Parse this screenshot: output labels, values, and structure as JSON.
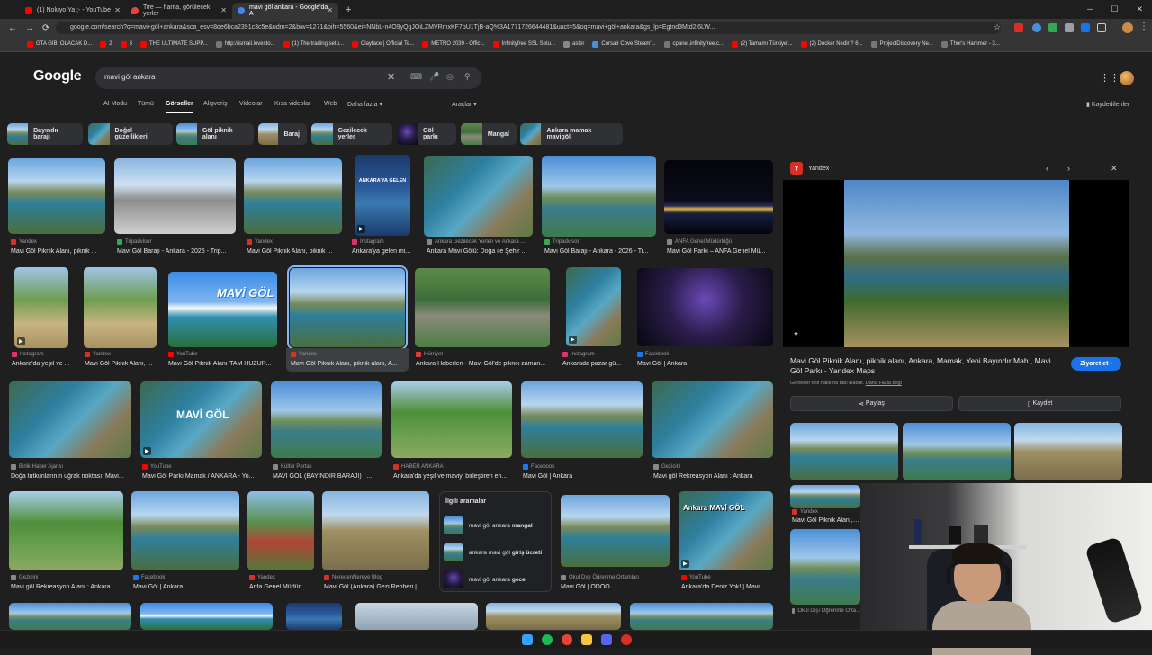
{
  "tabs": [
    {
      "title": "(1) Noluyo Ya ;- - YouTube",
      "color": "#ff0000"
    },
    {
      "title": "Tire — harita, görülecek yerler",
      "color": "#ea4335"
    },
    {
      "title": "mavi göl ankara - Google'da A",
      "color": "#4285f4"
    }
  ],
  "address": {
    "url": "google.com/search?q=mavi+göl+ankara&sca_esv=8de6bca2391c3c5e&udm=2&biw=1271&bih=5560&ei=NNbL-n4O9yQgJOiLZMVRmxKF7bU1TjB-aQ%3A1771726644481&uact=5&oq=mavi+göl+ankara&gs_lp=Egtnd3Mtd2l6LW..."
  },
  "bookmarks": [
    {
      "label": "GTA GİBİ OLACAK D...",
      "color": "#ff0000"
    },
    {
      "label": "2",
      "color": "#ff0000"
    },
    {
      "label": "3",
      "color": "#ff0000"
    },
    {
      "label": "THE ULTIMATE SUPP...",
      "color": "#ff0000"
    },
    {
      "label": "http://ismail.lovesto...",
      "color": "#777777"
    },
    {
      "label": "(1) The trading setu...",
      "color": "#ff0000"
    },
    {
      "label": "Clayface | Official Te...",
      "color": "#ff0000"
    },
    {
      "label": "METRO 2039 - Offic...",
      "color": "#ff0000"
    },
    {
      "label": "Infinityfree SSL Setu...",
      "color": "#ff0000"
    },
    {
      "label": "aster",
      "color": "#888888"
    },
    {
      "label": "Corsair Cove Steam'...",
      "color": "#4a90d9"
    },
    {
      "label": "cpanel.infinityfree.c...",
      "color": "#777777"
    },
    {
      "label": "(2) Tamamı Türkiye'...",
      "color": "#ff0000"
    },
    {
      "label": "(2) Docker Nedir ? 6...",
      "color": "#ff0000"
    },
    {
      "label": "ProjectDiscovery Ne...",
      "color": "#777777"
    },
    {
      "label": "Thor's Hammer - 3...",
      "color": "#777777"
    }
  ],
  "google": {
    "logo": "Google",
    "query": "mavi göl ankara",
    "nav": [
      "AI Modu",
      "Tümü",
      "Görseller",
      "Alışveriş",
      "Videolar",
      "Kısa videolar",
      "Web",
      "Daha fazla",
      "Araçlar"
    ],
    "saved": "Kaydedilenler"
  },
  "chips": [
    "Bayındır barajı",
    "Doğal güzellikleri",
    "Göl piknik alanı",
    "Baraj",
    "Gezilecek yerler",
    "Göl parkı",
    "Mangal",
    "Ankara mamak mavigöl"
  ],
  "results": [
    {
      "source": "Yandex",
      "caption": "Mavi Göl Piknik Alanı, piknik ...",
      "src_color": "#d93025"
    },
    {
      "source": "Tripadvisor",
      "caption": "Mavi Göl Barajı - Ankara - 2026 - Trip...",
      "src_color": "#34a853"
    },
    {
      "source": "Yandex",
      "caption": "Mavi Göl Piknik Alanı, piknik ...",
      "src_color": "#d93025"
    },
    {
      "source": "Instagram",
      "caption": "Ankara'ya gelen mi...",
      "src_color": "#e1306c"
    },
    {
      "source": "Ankara Gezilecek Yerleri ve Ankara ...",
      "caption": "Ankara Mavi Gölü: Doğa ile Şehir ...",
      "src_color": "#888888"
    },
    {
      "source": "Tripadvisor",
      "caption": "Mavi Göl Barajı - Ankara - 2026 - Tr...",
      "src_color": "#34a853"
    },
    {
      "source": "ANFA Genel Müdürlüğü",
      "caption": "Mavi Göl Parkı – ANFA Genel Mü...",
      "src_color": "#888888"
    },
    {
      "source": "Instagram",
      "caption": "Ankara'da yeşil ve ...",
      "src_color": "#e1306c"
    },
    {
      "source": "Yandex",
      "caption": "Mavi Göl Piknik Alanı, ...",
      "src_color": "#d93025"
    },
    {
      "source": "YouTube",
      "caption": "Mavi Göl Piknik Alanı-TAM HUZUR...",
      "src_color": "#ff0000"
    },
    {
      "source": "Yandex",
      "caption": "Mavi Göl Piknik Alanı, piknik alanı, A...",
      "src_color": "#d93025"
    },
    {
      "source": "Hürriyet",
      "caption": "Ankara Haberleri - Mavi Göl'de piknik zaman...",
      "src_color": "#e53935"
    },
    {
      "source": "Instagram",
      "caption": "Ankarada pazar gü...",
      "src_color": "#e1306c"
    },
    {
      "source": "Facebook",
      "caption": "Mavi Göl | Ankara",
      "src_color": "#1877f2"
    },
    {
      "source": "Birlik Haber Ajansı",
      "caption": "Doğa tutkunlarının uğrak noktası: Mavi...",
      "src_color": "#888888"
    },
    {
      "source": "YouTube",
      "caption": "Mavi Göl Parkı Mamak / ANKARA - Yo...",
      "src_color": "#ff0000"
    },
    {
      "source": "Kültür Portalı",
      "caption": "MAVİ GÖL (BAYINDIR BARAJI) | ...",
      "src_color": "#888888"
    },
    {
      "source": "HABER ANKARA",
      "caption": "Ankara'da yeşil ve maviyi birleştiren en...",
      "src_color": "#d93025"
    },
    {
      "source": "Facebook",
      "caption": "Mavi Göl | Ankara",
      "src_color": "#1877f2"
    },
    {
      "source": "Gezicini",
      "caption": "Mavi göl Rekreasyon Alanı : Ankara",
      "src_color": "#888888"
    },
    {
      "source": "Gezicini",
      "caption": "Mavi göl Rekreasyon Alanı : Ankara",
      "src_color": "#888888"
    },
    {
      "source": "Facebook",
      "caption": "Mavi Göl | Ankara",
      "src_color": "#1877f2"
    },
    {
      "source": "Yandex",
      "caption": "Anfa Genel Müdürl...",
      "src_color": "#d93025"
    },
    {
      "source": "NeredenNereye Blog",
      "caption": "Mavi Göl (Ankara) Gezi Rehberi | ...",
      "src_color": "#d93025"
    },
    {
      "source": "Okul Dışı Öğrenme Ortamları",
      "caption": "Mavi Göl | ODÖO",
      "src_color": "#888888"
    },
    {
      "source": "YouTube",
      "caption": "Ankara'da Deniz Yok! | Mavi ...",
      "src_color": "#ff0000"
    }
  ],
  "thumb_texts": {
    "kastamonu": "ANKARA'YA GELEN",
    "mavigol": "MAVİ GÖL",
    "mavigol2": "MAVİ GÖL",
    "ankara_mavi": "Ankara MAVİ GÖL"
  },
  "related": {
    "title": "İlgili aramalar",
    "items": [
      {
        "pre": "mavi göl ankara ",
        "bold": "mangal"
      },
      {
        "pre": "ankara mavi göl ",
        "bold": "giriş ücreti"
      },
      {
        "pre": "mavi göl ankara ",
        "bold": "gece"
      }
    ]
  },
  "panel": {
    "source": "Yandex",
    "title": "Mavi Göl Piknik Alanı, piknik alanı, Ankara, Mamak, Yeni Bayındır Mah., Mavi Göl Parkı - Yandex Maps",
    "visit": "Ziyaret et",
    "note_pre": "Görseller telif hakkına tabi olabilir. ",
    "note_link": "Daha Fazla Bilgi",
    "share": "Paylaş",
    "save": "Kaydet",
    "sub_source": "Yandex",
    "sub_caption": "Mavi Göl Piknik Alanı, pik...",
    "sub_source2": "Okul Dışı Öğrenme Orta..."
  }
}
